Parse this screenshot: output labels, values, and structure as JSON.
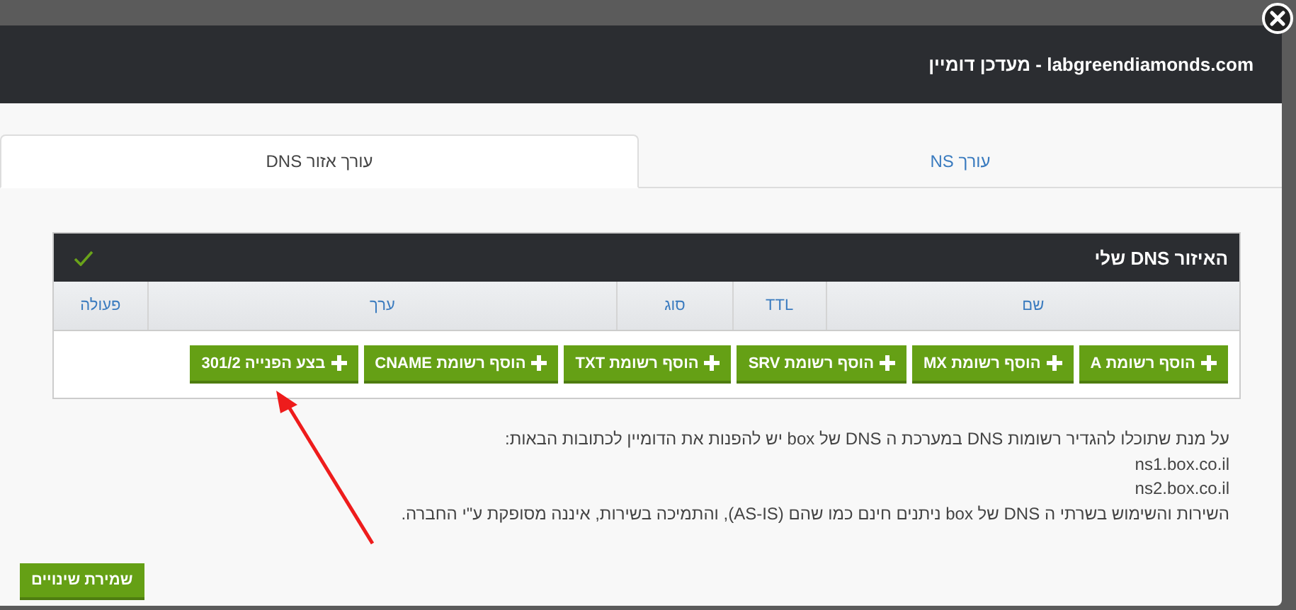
{
  "window": {
    "title": "labgreendiamonds.com - מעדכן דומיין"
  },
  "tabs": [
    {
      "label": "עורך NS",
      "selected": false
    },
    {
      "label": "עורך אזור DNS",
      "selected": true
    }
  ],
  "panel": {
    "title": "האיזור DNS שלי",
    "saved": true
  },
  "table": {
    "columns": [
      "שם",
      "TTL",
      "סוג",
      "ערך",
      "פעולה"
    ]
  },
  "add_buttons": [
    "הוסף רשומת A",
    "הוסף רשומת MX",
    "הוסף רשומת SRV",
    "הוסף רשומת TXT",
    "הוסף רשומת CNAME",
    "בצע הפנייה 301/2"
  ],
  "info_lines": [
    "על מנת שתוכלו להגדיר רשומות DNS במערכת ה DNS של box יש להפנות את הדומיין לכתובות הבאות:",
    "ns1.box.co.il",
    "ns2.box.co.il",
    "השירות והשימוש בשרתי ה DNS של box ניתנים חינם כמו שהם (AS-IS), והתמיכה בשירות, איננה מסופקת ע\"י החברה."
  ],
  "save_button": "שמירת שינויים"
}
